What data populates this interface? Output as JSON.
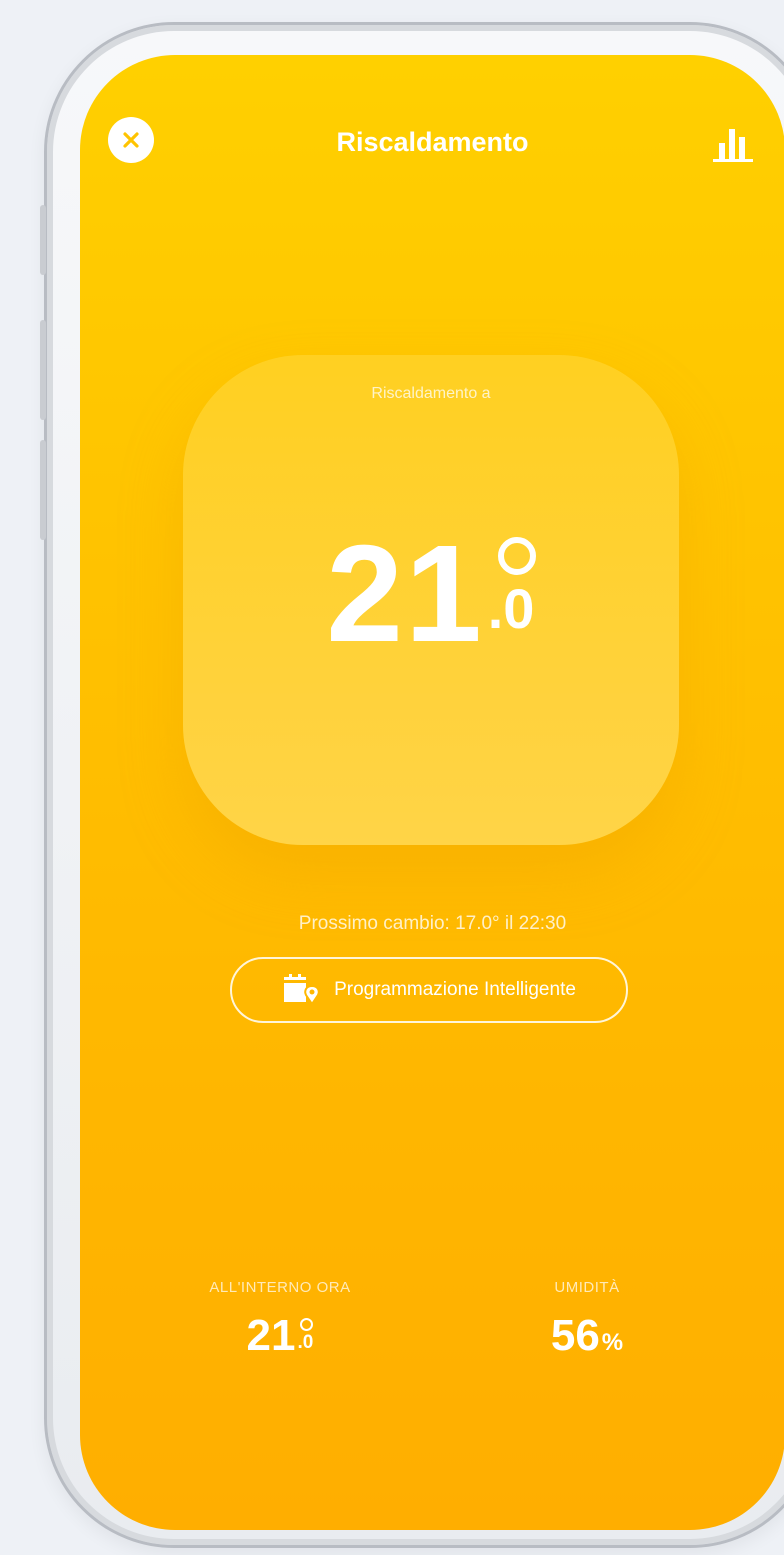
{
  "header": {
    "title": "Riscaldamento",
    "close_icon": "close-icon",
    "stats_icon": "bar-chart-icon"
  },
  "card": {
    "label": "Riscaldamento a",
    "temp_int": "21",
    "temp_dec": ".0"
  },
  "schedule": {
    "next_change": "Prossimo cambio: 17.0° il 22:30",
    "button_label": "Programmazione Intelligente",
    "button_icon": "calendar-location-icon"
  },
  "indoor": {
    "label": "ALL'INTERNO ORA",
    "temp_int": "21",
    "temp_dec": ".0"
  },
  "humidity": {
    "label": "UMIDITÀ",
    "value": "56",
    "unit": "%"
  },
  "colors": {
    "accent_top": "#ffd000",
    "accent_bottom": "#ffae00",
    "text": "#ffffff"
  }
}
